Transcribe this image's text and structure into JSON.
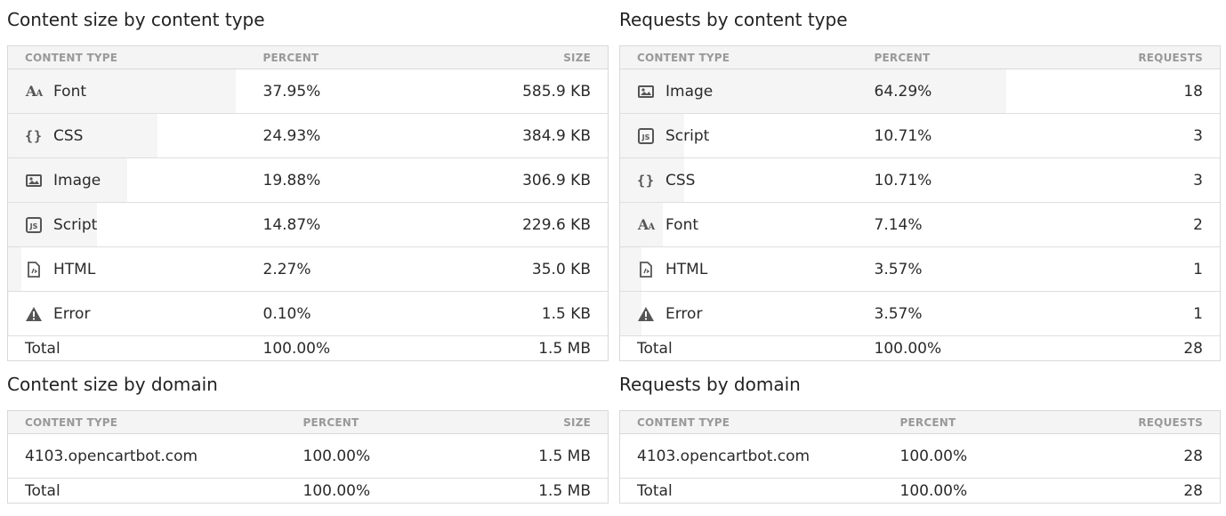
{
  "panels": {
    "size_by_type": {
      "title": "Content size by content type",
      "headers": [
        "CONTENT TYPE",
        "PERCENT",
        "SIZE"
      ],
      "rows": [
        {
          "icon": "font-icon",
          "type": "Font",
          "percent": "37.95%",
          "value": "585.9 KB",
          "fraction": 0.3795
        },
        {
          "icon": "css-icon",
          "type": "CSS",
          "percent": "24.93%",
          "value": "384.9 KB",
          "fraction": 0.2493
        },
        {
          "icon": "image-icon",
          "type": "Image",
          "percent": "19.88%",
          "value": "306.9 KB",
          "fraction": 0.1988
        },
        {
          "icon": "script-icon",
          "type": "Script",
          "percent": "14.87%",
          "value": "229.6 KB",
          "fraction": 0.1487
        },
        {
          "icon": "html-icon",
          "type": "HTML",
          "percent": "2.27%",
          "value": "35.0 KB",
          "fraction": 0.0227
        },
        {
          "icon": "warning-icon",
          "type": "Error",
          "percent": "0.10%",
          "value": "1.5 KB",
          "fraction": 0.001
        }
      ],
      "total": {
        "label": "Total",
        "percent": "100.00%",
        "value": "1.5 MB"
      }
    },
    "requests_by_type": {
      "title": "Requests by content type",
      "headers": [
        "CONTENT TYPE",
        "PERCENT",
        "REQUESTS"
      ],
      "rows": [
        {
          "icon": "image-icon",
          "type": "Image",
          "percent": "64.29%",
          "value": "18",
          "fraction": 0.6429
        },
        {
          "icon": "script-icon",
          "type": "Script",
          "percent": "10.71%",
          "value": "3",
          "fraction": 0.1071
        },
        {
          "icon": "css-icon",
          "type": "CSS",
          "percent": "10.71%",
          "value": "3",
          "fraction": 0.1071
        },
        {
          "icon": "font-icon",
          "type": "Font",
          "percent": "7.14%",
          "value": "2",
          "fraction": 0.0714
        },
        {
          "icon": "html-icon",
          "type": "HTML",
          "percent": "3.57%",
          "value": "1",
          "fraction": 0.0357
        },
        {
          "icon": "warning-icon",
          "type": "Error",
          "percent": "3.57%",
          "value": "1",
          "fraction": 0.0357
        }
      ],
      "total": {
        "label": "Total",
        "percent": "100.00%",
        "value": "28"
      }
    },
    "size_by_domain": {
      "title": "Content size by domain",
      "headers": [
        "CONTENT TYPE",
        "PERCENT",
        "SIZE"
      ],
      "rows": [
        {
          "type": "4103.opencartbot.com",
          "percent": "100.00%",
          "value": "1.5 MB"
        }
      ],
      "total": {
        "label": "Total",
        "percent": "100.00%",
        "value": "1.5 MB"
      }
    },
    "requests_by_domain": {
      "title": "Requests by domain",
      "headers": [
        "CONTENT TYPE",
        "PERCENT",
        "REQUESTS"
      ],
      "rows": [
        {
          "type": "4103.opencartbot.com",
          "percent": "100.00%",
          "value": "28"
        }
      ],
      "total": {
        "label": "Total",
        "percent": "100.00%",
        "value": "28"
      }
    }
  }
}
